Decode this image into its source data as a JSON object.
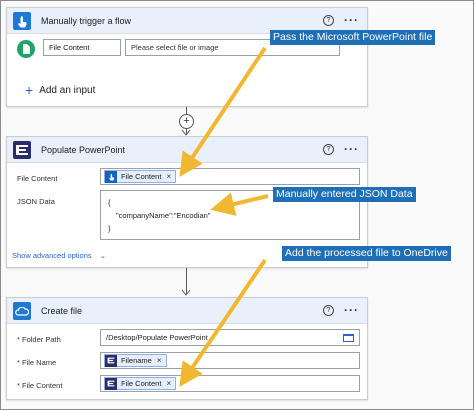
{
  "trigger": {
    "title": "Manually trigger a flow",
    "input_label": "File Content",
    "input_placeholder": "Please select file or image",
    "add_input": "Add an input"
  },
  "populate": {
    "title": "Populate PowerPoint",
    "file_content_label": "File Content",
    "file_content_token": "File Content",
    "json_label": "JSON Data",
    "json_line1": "{",
    "json_line2": "\"companyName\":\"Encodian\"",
    "json_line3": "}",
    "advanced": "Show advanced options"
  },
  "create": {
    "title": "Create file",
    "folder_label": "* Folder Path",
    "folder_value": "/Desktop/Populate PowerPoint",
    "name_label": "* File Name",
    "name_token": "Filename",
    "content_label": "* File Content",
    "content_token": "File Content"
  },
  "annotations": {
    "a1": "Pass the Microsoft PowerPoint file",
    "a2": "Manually entered JSON Data",
    "a3": "Add the processed file to OneDrive"
  },
  "icons": {
    "help": "?",
    "more": "···",
    "remove": "×",
    "plus": "+",
    "chevron": "⌄"
  },
  "colors": {
    "accent_blue": "#1f6fb6",
    "arrow_yellow": "#f2b731",
    "token_blue": "#1565c0"
  }
}
